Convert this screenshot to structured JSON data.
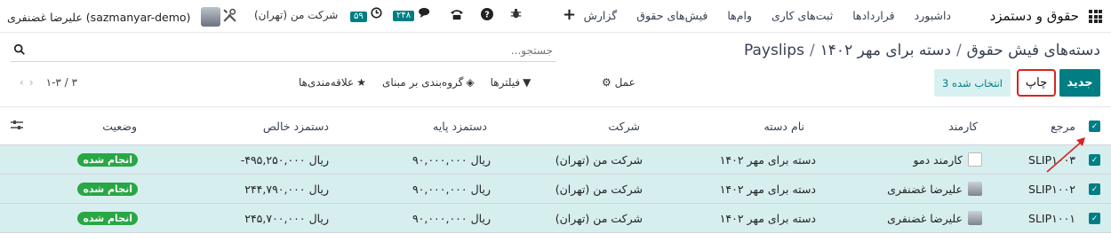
{
  "navbar": {
    "brand": "حقوق و دستمزد",
    "menu": [
      "داشبورد",
      "قراردادها",
      "ثبت‌های کاری",
      "وام‌ها",
      "فیش‌های حقوق",
      "گزارش"
    ],
    "user": "علیرضا غضنفری (sazmanyar-demo)",
    "company": "شرکت من (تهران)",
    "activity_count": "۵۹",
    "messages_count": "۲۴۸"
  },
  "breadcrumb": {
    "root": "دسته‌های فیش حقوق",
    "middle": "دسته برای مهر ۱۴۰۲",
    "current": "Payslips"
  },
  "search": {
    "placeholder": "جستجو..."
  },
  "toolbar": {
    "new_label": "جدید",
    "print_label": "چاپ",
    "selected_label": "3 انتخاب شده",
    "action_label": "عمل",
    "filters_label": "فیلترها",
    "groupby_label": "گروه‌بندی بر مبنای",
    "favorites_label": "علاقه‌مندی‌ها",
    "pager": "۱-۳ / ۳"
  },
  "table": {
    "headers": {
      "reference": "مرجع",
      "employee": "کارمند",
      "batch": "نام دسته",
      "company": "شرکت",
      "basic": "دستمزد پایه",
      "net": "دستمزد خالص",
      "status": "وضعیت"
    },
    "rows": [
      {
        "reference": "SLIP۱۰۰۳",
        "employee": "کارمند دمو",
        "batch": "دسته برای مهر ۱۴۰۲",
        "company": "شرکت من (تهران)",
        "basic": "ریال ۹۰,۰۰۰,۰۰۰",
        "net": "ریال ۴۹۵,۲۵۰,۰۰۰-",
        "status": "انجام شده"
      },
      {
        "reference": "SLIP۱۰۰۲",
        "employee": "علیرضا غضنفری",
        "batch": "دسته برای مهر ۱۴۰۲",
        "company": "شرکت من (تهران)",
        "basic": "ریال ۹۰,۰۰۰,۰۰۰",
        "net": "ریال ۲۴۴,۷۹۰,۰۰۰",
        "status": "انجام شده"
      },
      {
        "reference": "SLIP۱۰۰۱",
        "employee": "علیرضا غضنفری",
        "batch": "دسته برای مهر ۱۴۰۲",
        "company": "شرکت من (تهران)",
        "basic": "ریال ۹۰,۰۰۰,۰۰۰",
        "net": "ریال ۲۴۵,۷۰۰,۰۰۰",
        "status": "انجام شده"
      }
    ]
  },
  "colors": {
    "accent": "#017e84",
    "selected_row": "#d7eeef",
    "status_done": "#28a745",
    "highlight": "#d62424"
  }
}
